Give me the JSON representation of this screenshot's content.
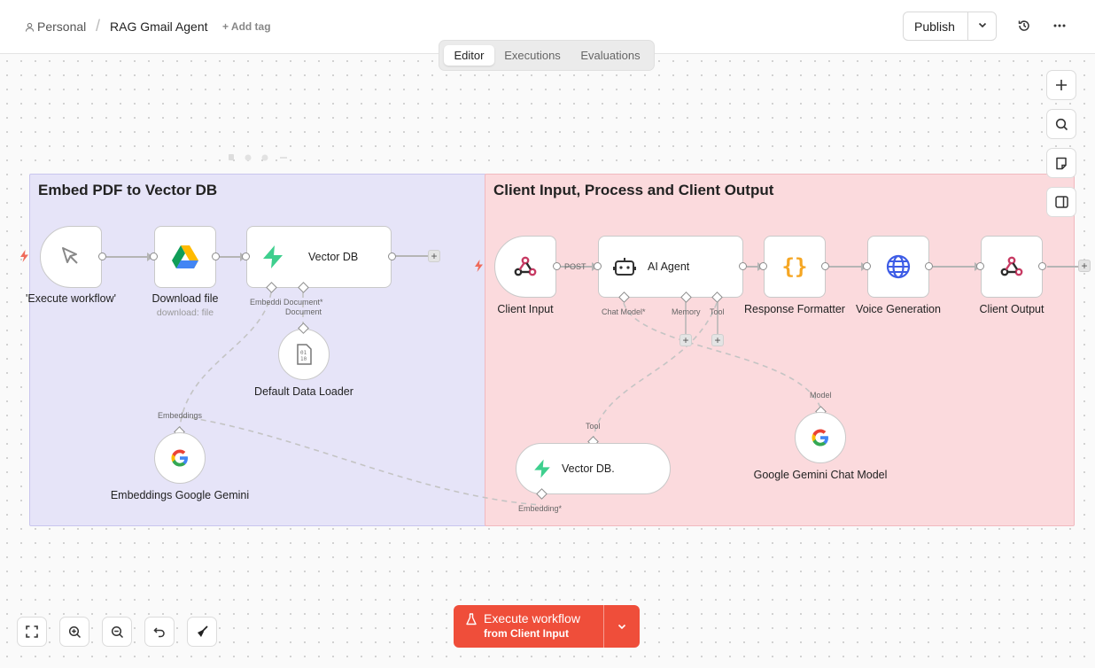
{
  "header": {
    "breadcrumb_owner": "Personal",
    "workflow_name": "RAG Gmail Agent",
    "add_tag": "+ Add tag",
    "publish_label": "Publish"
  },
  "tabs": [
    {
      "label": "Editor",
      "active": true
    },
    {
      "label": "Executions",
      "active": false
    },
    {
      "label": "Evaluations",
      "active": false
    }
  ],
  "groups": [
    {
      "title": "Embed PDF to Vector DB",
      "color": "#e6e4f8"
    },
    {
      "title": "Client Input, Process and Client Output",
      "color": "#fbdadd"
    }
  ],
  "nodes": {
    "execute_workflow": {
      "label": "'Execute workflow'"
    },
    "download_file": {
      "label": "Download file",
      "subtitle": "download: file"
    },
    "vector_db": {
      "label": "Vector DB"
    },
    "default_data_loader": {
      "label": "Default Data Loader"
    },
    "embeddings_google_gemini": {
      "label": "Embeddings Google Gemini"
    },
    "client_input": {
      "label": "Client Input"
    },
    "ai_agent": {
      "label": "AI Agent"
    },
    "response_formatter": {
      "label": "Response Formatter"
    },
    "voice_generation": {
      "label": "Voice Generation"
    },
    "client_output": {
      "label": "Client Output"
    },
    "vector_db_tool": {
      "label": "Vector DB."
    },
    "google_gemini_chat_model": {
      "label": "Google Gemini Chat Model"
    }
  },
  "ports": {
    "embeddi": "Embeddi",
    "document_req": "Document*",
    "document": "Document",
    "embeddings": "Embeddings",
    "post": "POST",
    "chat_model": "Chat Model*",
    "memory": "Memory",
    "tool": "Tool",
    "model": "Model",
    "tool_in": "Tool",
    "embedding_req": "Embedding*"
  },
  "execute_button": {
    "title": "Execute workflow",
    "subtitle": "from Client Input",
    "color": "#ef4e3a"
  },
  "colors": {
    "trigger_flash": "#ef6b5b",
    "supabase_green": "#3ecf8e",
    "webhook_pink": "#c73a63",
    "globe_blue": "#3d5ce6",
    "braces_orange": "#f5a623"
  }
}
